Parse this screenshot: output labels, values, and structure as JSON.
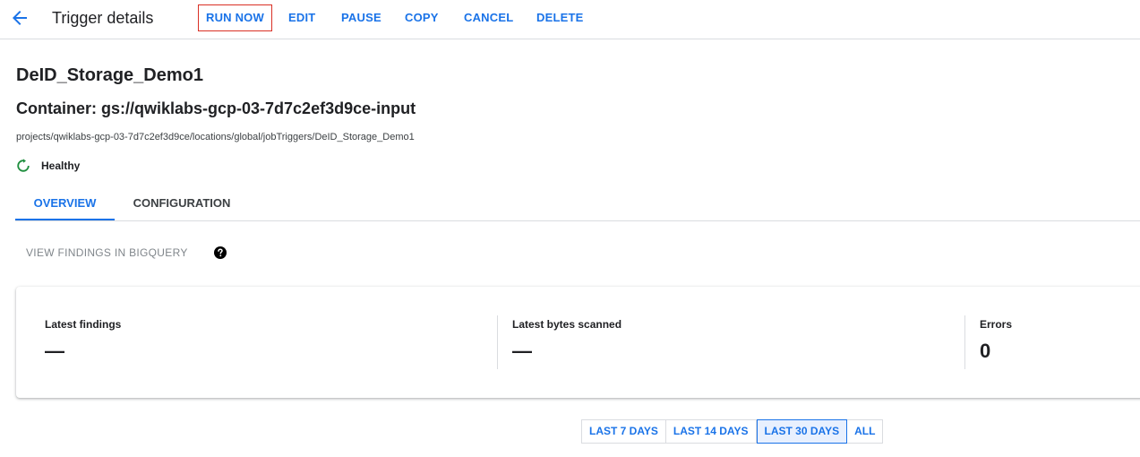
{
  "header": {
    "title": "Trigger details",
    "actions": [
      "RUN NOW",
      "EDIT",
      "PAUSE",
      "COPY",
      "CANCEL",
      "DELETE"
    ]
  },
  "trigger": {
    "name": "DeID_Storage_Demo1",
    "container": "Container: gs://qwiklabs-gcp-03-7d7c2ef3d9ce-input",
    "path": "projects/qwiklabs-gcp-03-7d7c2ef3d9ce/locations/global/jobTriggers/DeID_Storage_Demo1",
    "status": "Healthy"
  },
  "tabs": [
    {
      "label": "OVERVIEW",
      "active": true
    },
    {
      "label": "CONFIGURATION",
      "active": false
    }
  ],
  "overview": {
    "bigquery_link": "VIEW FINDINGS IN BIGQUERY",
    "metrics": [
      {
        "label": "Latest findings",
        "value": "—"
      },
      {
        "label": "Latest bytes scanned",
        "value": "—"
      },
      {
        "label": "Errors",
        "value": "0"
      }
    ],
    "ranges": [
      {
        "label": "LAST 7 DAYS",
        "selected": false
      },
      {
        "label": "LAST 14 DAYS",
        "selected": false
      },
      {
        "label": "LAST 30 DAYS",
        "selected": true
      },
      {
        "label": "ALL",
        "selected": false
      }
    ]
  },
  "colors": {
    "accent": "#1a73e8",
    "healthy": "#1e8e3e",
    "highlight_border": "#d93025"
  },
  "icons": {
    "back": "arrow-back-icon",
    "status": "healthy-refresh-icon",
    "help": "help-circle-icon"
  }
}
